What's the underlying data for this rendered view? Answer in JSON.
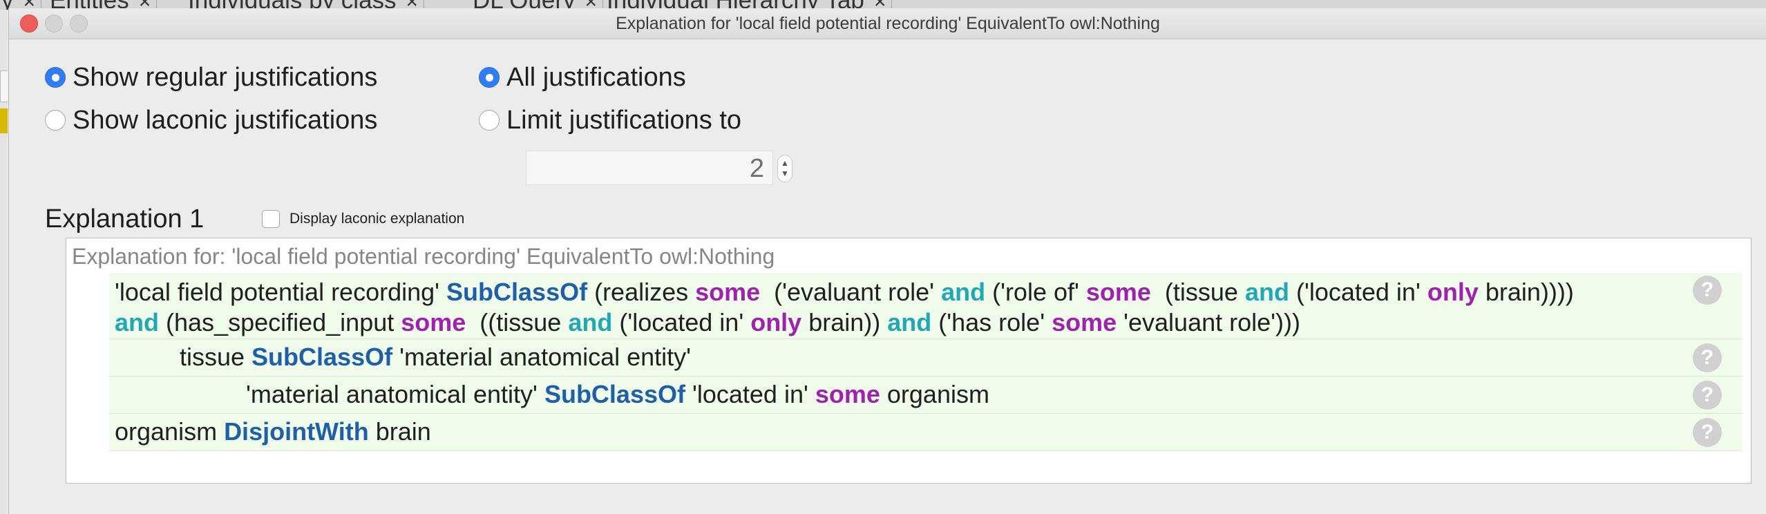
{
  "background": {
    "tabs": [
      {
        "label": "y",
        "close": "×"
      },
      {
        "label": "Entities",
        "close": "×"
      },
      {
        "label": "Individuals by class",
        "close": "×"
      },
      {
        "label": "DL Query",
        "close": "×"
      },
      {
        "label": "Individual Hierarchy Tab",
        "close": "×"
      }
    ]
  },
  "dialog": {
    "title": "Explanation for 'local field potential recording' EquivalentTo owl:Nothing"
  },
  "options": {
    "show_regular": "Show regular justifications",
    "show_laconic": "Show laconic justifications",
    "all_justifications": "All justifications",
    "limit_justifications": "Limit justifications to",
    "limit_value": "2",
    "selected_mode": "Show regular justifications",
    "selected_limit": "All justifications"
  },
  "explanation": {
    "title": "Explanation 1",
    "display_laconic_label": "Display laconic explanation",
    "header": "Explanation for: 'local field potential recording' EquivalentTo owl:Nothing",
    "help_glyph": "?",
    "axioms": [
      {
        "lines": [
          [
            {
              "t": "'local field potential recording' ",
              "c": "plain"
            },
            {
              "t": "SubClassOf",
              "c": "blue"
            },
            {
              "t": " (realizes ",
              "c": "plain"
            },
            {
              "t": "some",
              "c": "purple"
            },
            {
              "t": "  ('evaluant role' ",
              "c": "plain"
            },
            {
              "t": "and",
              "c": "teal"
            },
            {
              "t": " ('role of' ",
              "c": "plain"
            },
            {
              "t": "some",
              "c": "purple"
            },
            {
              "t": "  (tissue ",
              "c": "plain"
            },
            {
              "t": "and",
              "c": "teal"
            },
            {
              "t": " ('located in' ",
              "c": "plain"
            },
            {
              "t": "only",
              "c": "purple"
            },
            {
              "t": " brain))))",
              "c": "plain"
            }
          ],
          [
            {
              "t": "and",
              "c": "teal"
            },
            {
              "t": " (has_specified_input ",
              "c": "plain"
            },
            {
              "t": "some",
              "c": "purple"
            },
            {
              "t": "  ((tissue ",
              "c": "plain"
            },
            {
              "t": "and",
              "c": "teal"
            },
            {
              "t": " ('located in' ",
              "c": "plain"
            },
            {
              "t": "only",
              "c": "purple"
            },
            {
              "t": " brain)) ",
              "c": "plain"
            },
            {
              "t": "and",
              "c": "teal"
            },
            {
              "t": " ('has role' ",
              "c": "plain"
            },
            {
              "t": "some",
              "c": "purple"
            },
            {
              "t": " 'evaluant role')))",
              "c": "plain"
            }
          ]
        ]
      },
      {
        "lines": [
          [
            {
              "t": "tissue ",
              "c": "plain"
            },
            {
              "t": "SubClassOf",
              "c": "blue"
            },
            {
              "t": " 'material anatomical entity'",
              "c": "plain"
            }
          ]
        ]
      },
      {
        "lines": [
          [
            {
              "t": "'material anatomical entity' ",
              "c": "plain"
            },
            {
              "t": "SubClassOf",
              "c": "blue"
            },
            {
              "t": " 'located in' ",
              "c": "plain"
            },
            {
              "t": "some",
              "c": "purple"
            },
            {
              "t": " organism",
              "c": "plain"
            }
          ]
        ]
      },
      {
        "lines": [
          [
            {
              "t": "organism ",
              "c": "plain"
            },
            {
              "t": "DisjointWith",
              "c": "blue"
            },
            {
              "t": " brain",
              "c": "plain"
            }
          ]
        ]
      }
    ]
  },
  "colors": {
    "keyword_class": "#1e5fa8",
    "keyword_and": "#20a9b3",
    "keyword_quantifier": "#a020b0",
    "radio_selected": "#2f7cf6",
    "axiom_background": "#f1fbec"
  }
}
